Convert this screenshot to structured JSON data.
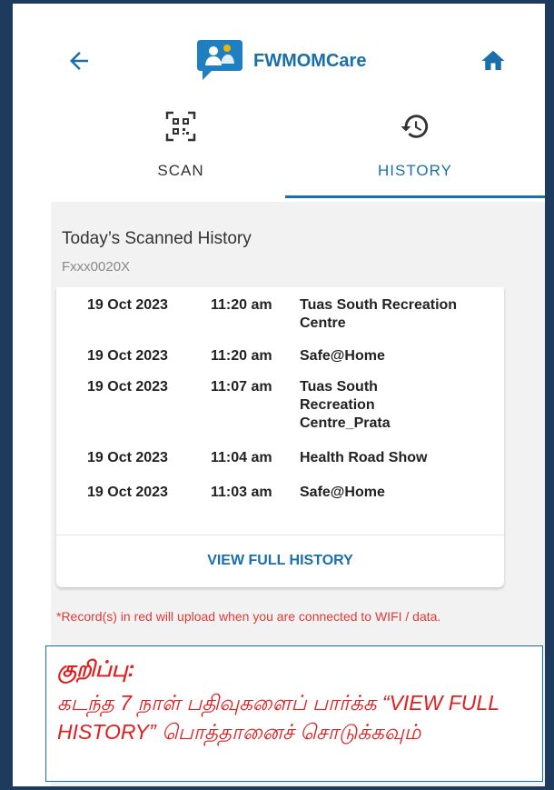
{
  "header": {
    "title": "FWMOMCare",
    "back_icon": "arrow-left-icon",
    "home_icon": "home-icon",
    "brand_color": "#1a6fa8"
  },
  "tabs": [
    {
      "label": "SCAN",
      "icon": "qr-code-icon",
      "active": false
    },
    {
      "label": "HISTORY",
      "icon": "history-clock-icon",
      "active": true
    }
  ],
  "history": {
    "title": "Today’s Scanned History",
    "user_id": "Fxxx0020X",
    "rows": [
      {
        "date": "19 Oct 2023",
        "time": "11:20 am",
        "location": "Tuas South Recreation Centre"
      },
      {
        "date": "19 Oct 2023",
        "time": "11:20 am",
        "location": "Safe@Home"
      },
      {
        "date": "19 Oct 2023",
        "time": "11:07 am",
        "location": "Tuas South Recreation Centre_Prata"
      },
      {
        "date": "19 Oct 2023",
        "time": "11:04 am",
        "location": "Health Road Show"
      },
      {
        "date": "19 Oct 2023",
        "time": "11:03 am",
        "location": "Safe@Home"
      }
    ],
    "view_full_label": "VIEW FULL HISTORY",
    "notice": "*Record(s) in red will upload when you are connected to WIFI / data."
  },
  "note": {
    "heading": "குறிப்பு:",
    "body": "கடந்த 7 நாள் பதிவுகளைப் பார்க்க “VIEW FULL HISTORY” பொத்தானைச் சொடுக்கவும்",
    "accent_color": "#e02020"
  }
}
